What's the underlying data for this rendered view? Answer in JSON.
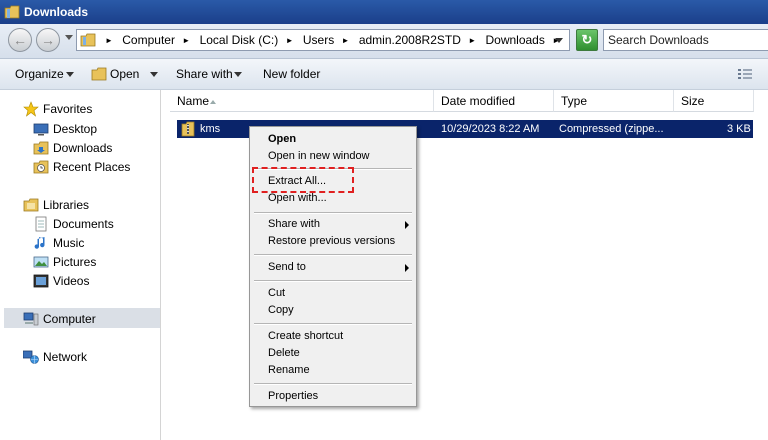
{
  "window": {
    "title": "Downloads"
  },
  "address": {
    "crumbs": [
      "Computer",
      "Local Disk (C:)",
      "Users",
      "admin.2008R2STD",
      "Downloads"
    ]
  },
  "search": {
    "placeholder": "Search Downloads"
  },
  "toolbar": {
    "organize": "Organize",
    "open": "Open",
    "share_with": "Share with",
    "new_folder": "New folder"
  },
  "nav": {
    "favorites": "Favorites",
    "desktop": "Desktop",
    "downloads": "Downloads",
    "recent_places": "Recent Places",
    "libraries": "Libraries",
    "documents": "Documents",
    "music": "Music",
    "pictures": "Pictures",
    "videos": "Videos",
    "computer": "Computer",
    "network": "Network"
  },
  "columns": {
    "name": "Name",
    "date_modified": "Date modified",
    "type": "Type",
    "size": "Size"
  },
  "files": [
    {
      "name": "kms",
      "date_modified": "10/29/2023 8:22 AM",
      "type": "Compressed (zippe...",
      "size": "3 KB"
    }
  ],
  "context_menu": {
    "open": "Open",
    "open_new_window": "Open in new window",
    "extract_all": "Extract All...",
    "open_with": "Open with...",
    "share_with": "Share with",
    "restore": "Restore previous versions",
    "send_to": "Send to",
    "cut": "Cut",
    "copy": "Copy",
    "create_shortcut": "Create shortcut",
    "delete": "Delete",
    "rename": "Rename",
    "properties": "Properties"
  },
  "colors": {
    "selection": "#0a246a",
    "highlight": "#e02020",
    "titlebar": "#1b3f8a"
  }
}
